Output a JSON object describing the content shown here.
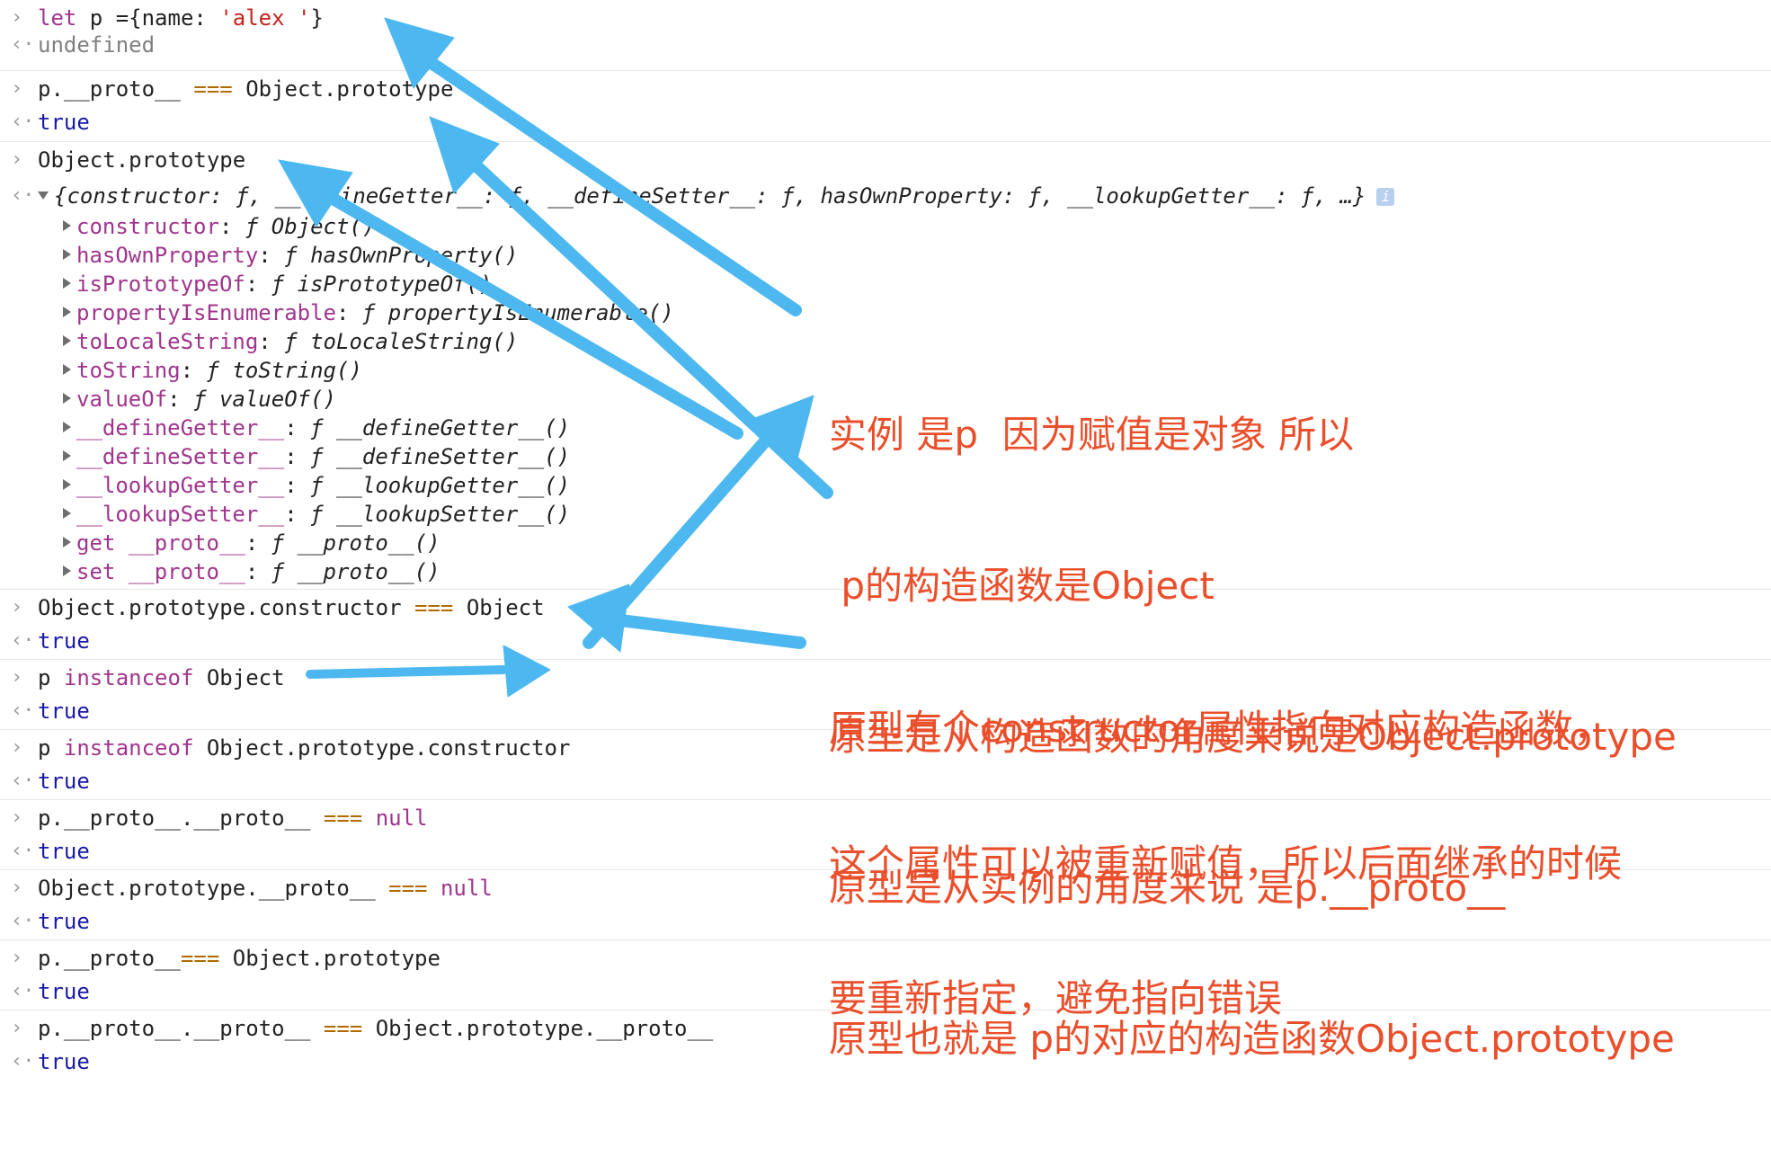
{
  "console": {
    "cmd1": {
      "let": "let",
      "mid": " p ={name: ",
      "str": "'alex '",
      "end": "}"
    },
    "res1": "undefined",
    "cmd2": {
      "a": "p.__proto__ ",
      "op": "===",
      "b": " Object.prototype"
    },
    "res2": "true",
    "cmd3": "Object.prototype",
    "obj_summary": "{constructor: ƒ, __defineGetter__: ƒ, __defineSetter__: ƒ, hasOwnProperty: ƒ, __lookupGetter__: ƒ, …}",
    "obj_info": "i",
    "props": [
      {
        "name": "constructor",
        "value": "ƒ Object()"
      },
      {
        "name": "hasOwnProperty",
        "value": "ƒ hasOwnProperty()"
      },
      {
        "name": "isPrototypeOf",
        "value": "ƒ isPrototypeOf()"
      },
      {
        "name": "propertyIsEnumerable",
        "value": "ƒ propertyIsEnumerable()"
      },
      {
        "name": "toLocaleString",
        "value": "ƒ toLocaleString()"
      },
      {
        "name": "toString",
        "value": "ƒ toString()"
      },
      {
        "name": "valueOf",
        "value": "ƒ valueOf()"
      },
      {
        "name": "__defineGetter__",
        "value": "ƒ __defineGetter__()"
      },
      {
        "name": "__defineSetter__",
        "value": "ƒ __defineSetter__()"
      },
      {
        "name": "__lookupGetter__",
        "value": "ƒ __lookupGetter__()"
      },
      {
        "name": "__lookupSetter__",
        "value": "ƒ __lookupSetter__()"
      },
      {
        "name": "get __proto__",
        "value": "ƒ __proto__()"
      },
      {
        "name": "set __proto__",
        "value": "ƒ __proto__()"
      }
    ],
    "cmd4": {
      "a": "Object.prototype.constructor ",
      "op": "===",
      "b": " Object"
    },
    "res4": "true",
    "cmd5": {
      "a": "p ",
      "kw": "instanceof",
      "b": " Object"
    },
    "res5": "true",
    "cmd6": {
      "a": "p ",
      "kw": "instanceof",
      "b": " Object.prototype.constructor"
    },
    "res6": "true",
    "cmd7": {
      "a": "p.__proto__.__proto__ ",
      "op": "===",
      "kw": " null"
    },
    "res7": "true",
    "cmd8": {
      "a": "Object.prototype.__proto__ ",
      "op": "===",
      "kw": " null"
    },
    "res8": "true",
    "cmd9": {
      "a": "p.__proto__",
      "op": "===",
      "b": " Object.prototype"
    },
    "res9": "true",
    "cmd10": {
      "a": "p.__proto__.__proto__ ",
      "op": "===",
      "b": " Object.prototype.__proto__"
    },
    "res10": "true"
  },
  "annotations": {
    "block1": [
      "实例 是p  因为赋值是对象 所以",
      " p的构造函数是Object",
      "原型是从构造函数的角度来说是Object.prototype",
      "原型是从实例的角度来说 是p.__proto__",
      "原型也就是 p的对应的构造函数Object.prototype"
    ],
    "block2": [
      "原型有个constructor属性指向对应构造函数，",
      "这个属性可以被重新赋值，所以后面继承的时候",
      "要重新指定，避免指向错误"
    ]
  },
  "colors": {
    "arrow": "#4db8f0",
    "annotation": "#ea4f2c",
    "keyword": "#a0358d",
    "string": "#c4231d",
    "boolean": "#1a1aa6"
  },
  "icons": {
    "input_prompt": "›",
    "output_prompt": "‹·"
  }
}
